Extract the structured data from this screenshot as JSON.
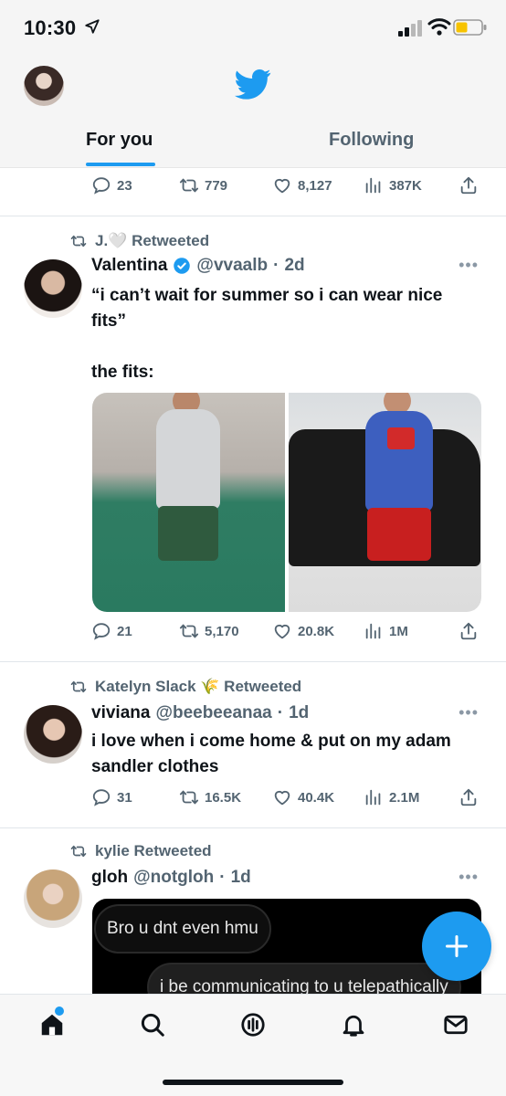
{
  "status_bar": {
    "time": "10:30"
  },
  "header": {
    "tabs": [
      {
        "label": "For you",
        "active": true
      },
      {
        "label": "Following",
        "active": false
      }
    ]
  },
  "colors": {
    "accent": "#1d9bf0",
    "text": "#0f1419",
    "secondary": "#536471"
  },
  "tweets": [
    {
      "stats": {
        "replies": "23",
        "retweets": "779",
        "likes": "8,127",
        "views": "387K"
      }
    },
    {
      "retweeted_by": "J.🤍 Retweeted",
      "name": "Valentina",
      "verified": true,
      "handle": "@vvaalb",
      "time": "2d",
      "text": "“i can’t wait for summer so i can wear nice fits”\n\nthe fits:",
      "stats": {
        "replies": "21",
        "retweets": "5,170",
        "likes": "20.8K",
        "views": "1M"
      }
    },
    {
      "retweeted_by": "Katelyn Slack 🌾 Retweeted",
      "name": "viviana",
      "handle": "@beebeeanaa",
      "time": "1d",
      "text": "i love when i come home & put on my adam sandler clothes",
      "stats": {
        "replies": "31",
        "retweets": "16.5K",
        "likes": "40.4K",
        "views": "2.1M"
      }
    },
    {
      "retweeted_by": "kylie Retweeted",
      "name": "gloh",
      "handle": "@notgloh",
      "time": "1d",
      "dm_messages": [
        "Bro u dnt even hmu",
        "i be communicating to u telepathically"
      ]
    }
  ],
  "icons": {
    "nav": [
      "home-icon",
      "search-icon",
      "spaces-icon",
      "notifications-icon",
      "messages-icon"
    ],
    "fab": "compose-icon"
  }
}
